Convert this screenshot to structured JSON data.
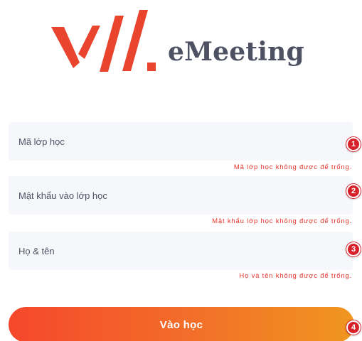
{
  "app": {
    "brand": "eMeeting",
    "brand_color": "#e8442e",
    "text_color": "#4e5161"
  },
  "form": {
    "class_code": {
      "placeholder": "Mã lớp học",
      "error": "Mã lớp học không được để trống.",
      "marker": "1"
    },
    "class_password": {
      "placeholder": "Mật khẩu vào lớp học",
      "error": "Mật khẩu lớp học không được để trống.",
      "marker": "2"
    },
    "full_name": {
      "placeholder": "Họ & tên",
      "error": "Họ và tên không được để trống.",
      "marker": "3"
    },
    "submit": {
      "label": "Vào học",
      "marker": "4"
    },
    "error_color": "#e5352b",
    "marker_color": "#d6202a",
    "button_gradient": [
      "#f5472b",
      "#f0961f"
    ]
  }
}
